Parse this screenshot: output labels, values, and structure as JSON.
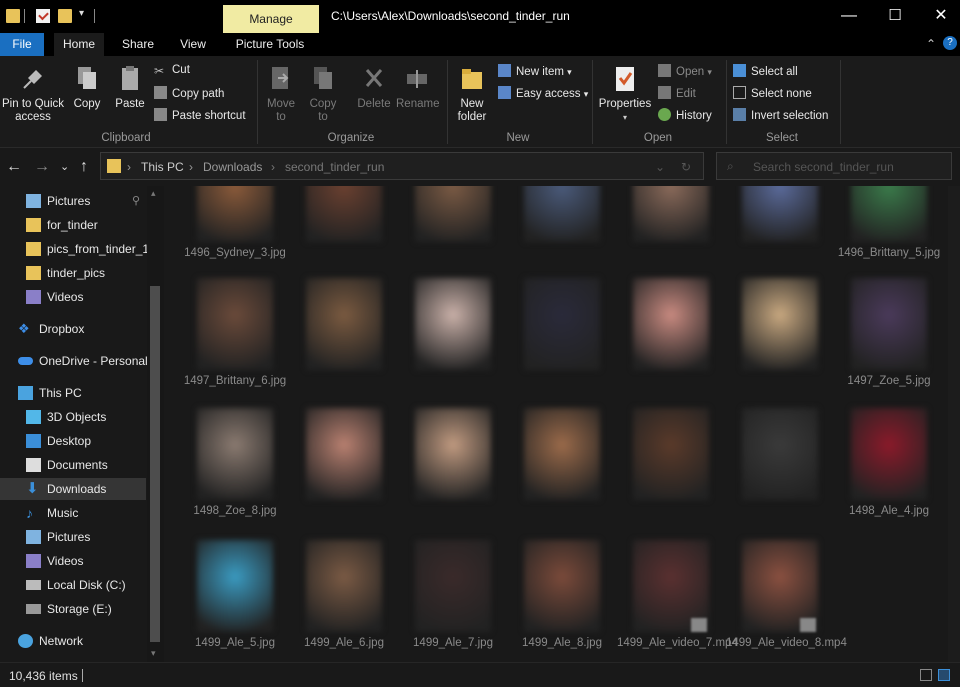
{
  "titlebar": {
    "manage_label": "Manage",
    "path": "C:\\Users\\Alex\\Downloads\\second_tinder_run",
    "minimize": "—",
    "maximize": "☐",
    "close": "✕"
  },
  "tabs": {
    "file": "File",
    "home": "Home",
    "share": "Share",
    "view": "View",
    "picture_tools": "Picture Tools"
  },
  "ribbon": {
    "clipboard": {
      "pin": "Pin to Quick access",
      "copy": "Copy",
      "paste": "Paste",
      "cut": "Cut",
      "copy_path": "Copy path",
      "paste_shortcut": "Paste shortcut",
      "label": "Clipboard"
    },
    "organize": {
      "move_to": "Move to",
      "copy_to": "Copy to",
      "delete": "Delete",
      "rename": "Rename",
      "label": "Organize"
    },
    "new": {
      "new_folder": "New folder",
      "new_item": "New item",
      "easy_access": "Easy access",
      "label": "New"
    },
    "open": {
      "properties": "Properties",
      "open": "Open",
      "edit": "Edit",
      "history": "History",
      "label": "Open"
    },
    "select": {
      "select_all": "Select all",
      "select_none": "Select none",
      "invert": "Invert selection",
      "label": "Select"
    }
  },
  "address": {
    "crumbs": [
      "This PC",
      "Downloads",
      "second_tinder_run"
    ],
    "search_placeholder": "Search second_tinder_run"
  },
  "sidebar": {
    "items": [
      {
        "label": "Pictures",
        "icon": "pictures-icon"
      },
      {
        "label": "for_tinder",
        "icon": "folder-icon"
      },
      {
        "label": "pics_from_tinder_1",
        "icon": "folder-icon"
      },
      {
        "label": "tinder_pics",
        "icon": "folder-icon"
      },
      {
        "label": "Videos",
        "icon": "videos-icon"
      },
      {
        "label": "Dropbox",
        "icon": "dropbox-icon"
      },
      {
        "label": "OneDrive - Personal",
        "icon": "onedrive-icon"
      },
      {
        "label": "This PC",
        "icon": "computer-icon"
      },
      {
        "label": "3D Objects",
        "icon": "3d-objects-icon"
      },
      {
        "label": "Desktop",
        "icon": "desktop-icon"
      },
      {
        "label": "Documents",
        "icon": "documents-icon"
      },
      {
        "label": "Downloads",
        "icon": "downloads-icon"
      },
      {
        "label": "Music",
        "icon": "music-icon"
      },
      {
        "label": "Pictures",
        "icon": "pictures-icon"
      },
      {
        "label": "Videos",
        "icon": "videos-icon"
      },
      {
        "label": "Local Disk (C:)",
        "icon": "disk-icon"
      },
      {
        "label": "Storage (E:)",
        "icon": "disk-icon"
      },
      {
        "label": "Network",
        "icon": "network-icon"
      }
    ]
  },
  "files": {
    "row1": [
      "1496_Sydney_3.jpg",
      "",
      "",
      "",
      "",
      "",
      "1496_Brittany_5.jpg"
    ],
    "row2": [
      "1497_Brittany_6.jpg",
      "",
      "",
      "",
      "",
      "",
      "1497_Zoe_5.jpg"
    ],
    "row3": [
      "1498_Zoe_8.jpg",
      "",
      "",
      "",
      "",
      "",
      "1498_Ale_4.jpg"
    ],
    "row4": [
      "1499_Ale_5.jpg",
      "1499_Ale_6.jpg",
      "1499_Ale_7.jpg",
      "1499_Ale_8.jpg",
      "1499_Ale_video_7.mp4",
      "1499_Ale_video_8.mp4",
      ""
    ]
  },
  "status": {
    "count": "10,436 items"
  },
  "colors": {
    "accent": "#1a6fc1",
    "manage_tab": "#f1eba3",
    "background": "#191919"
  }
}
